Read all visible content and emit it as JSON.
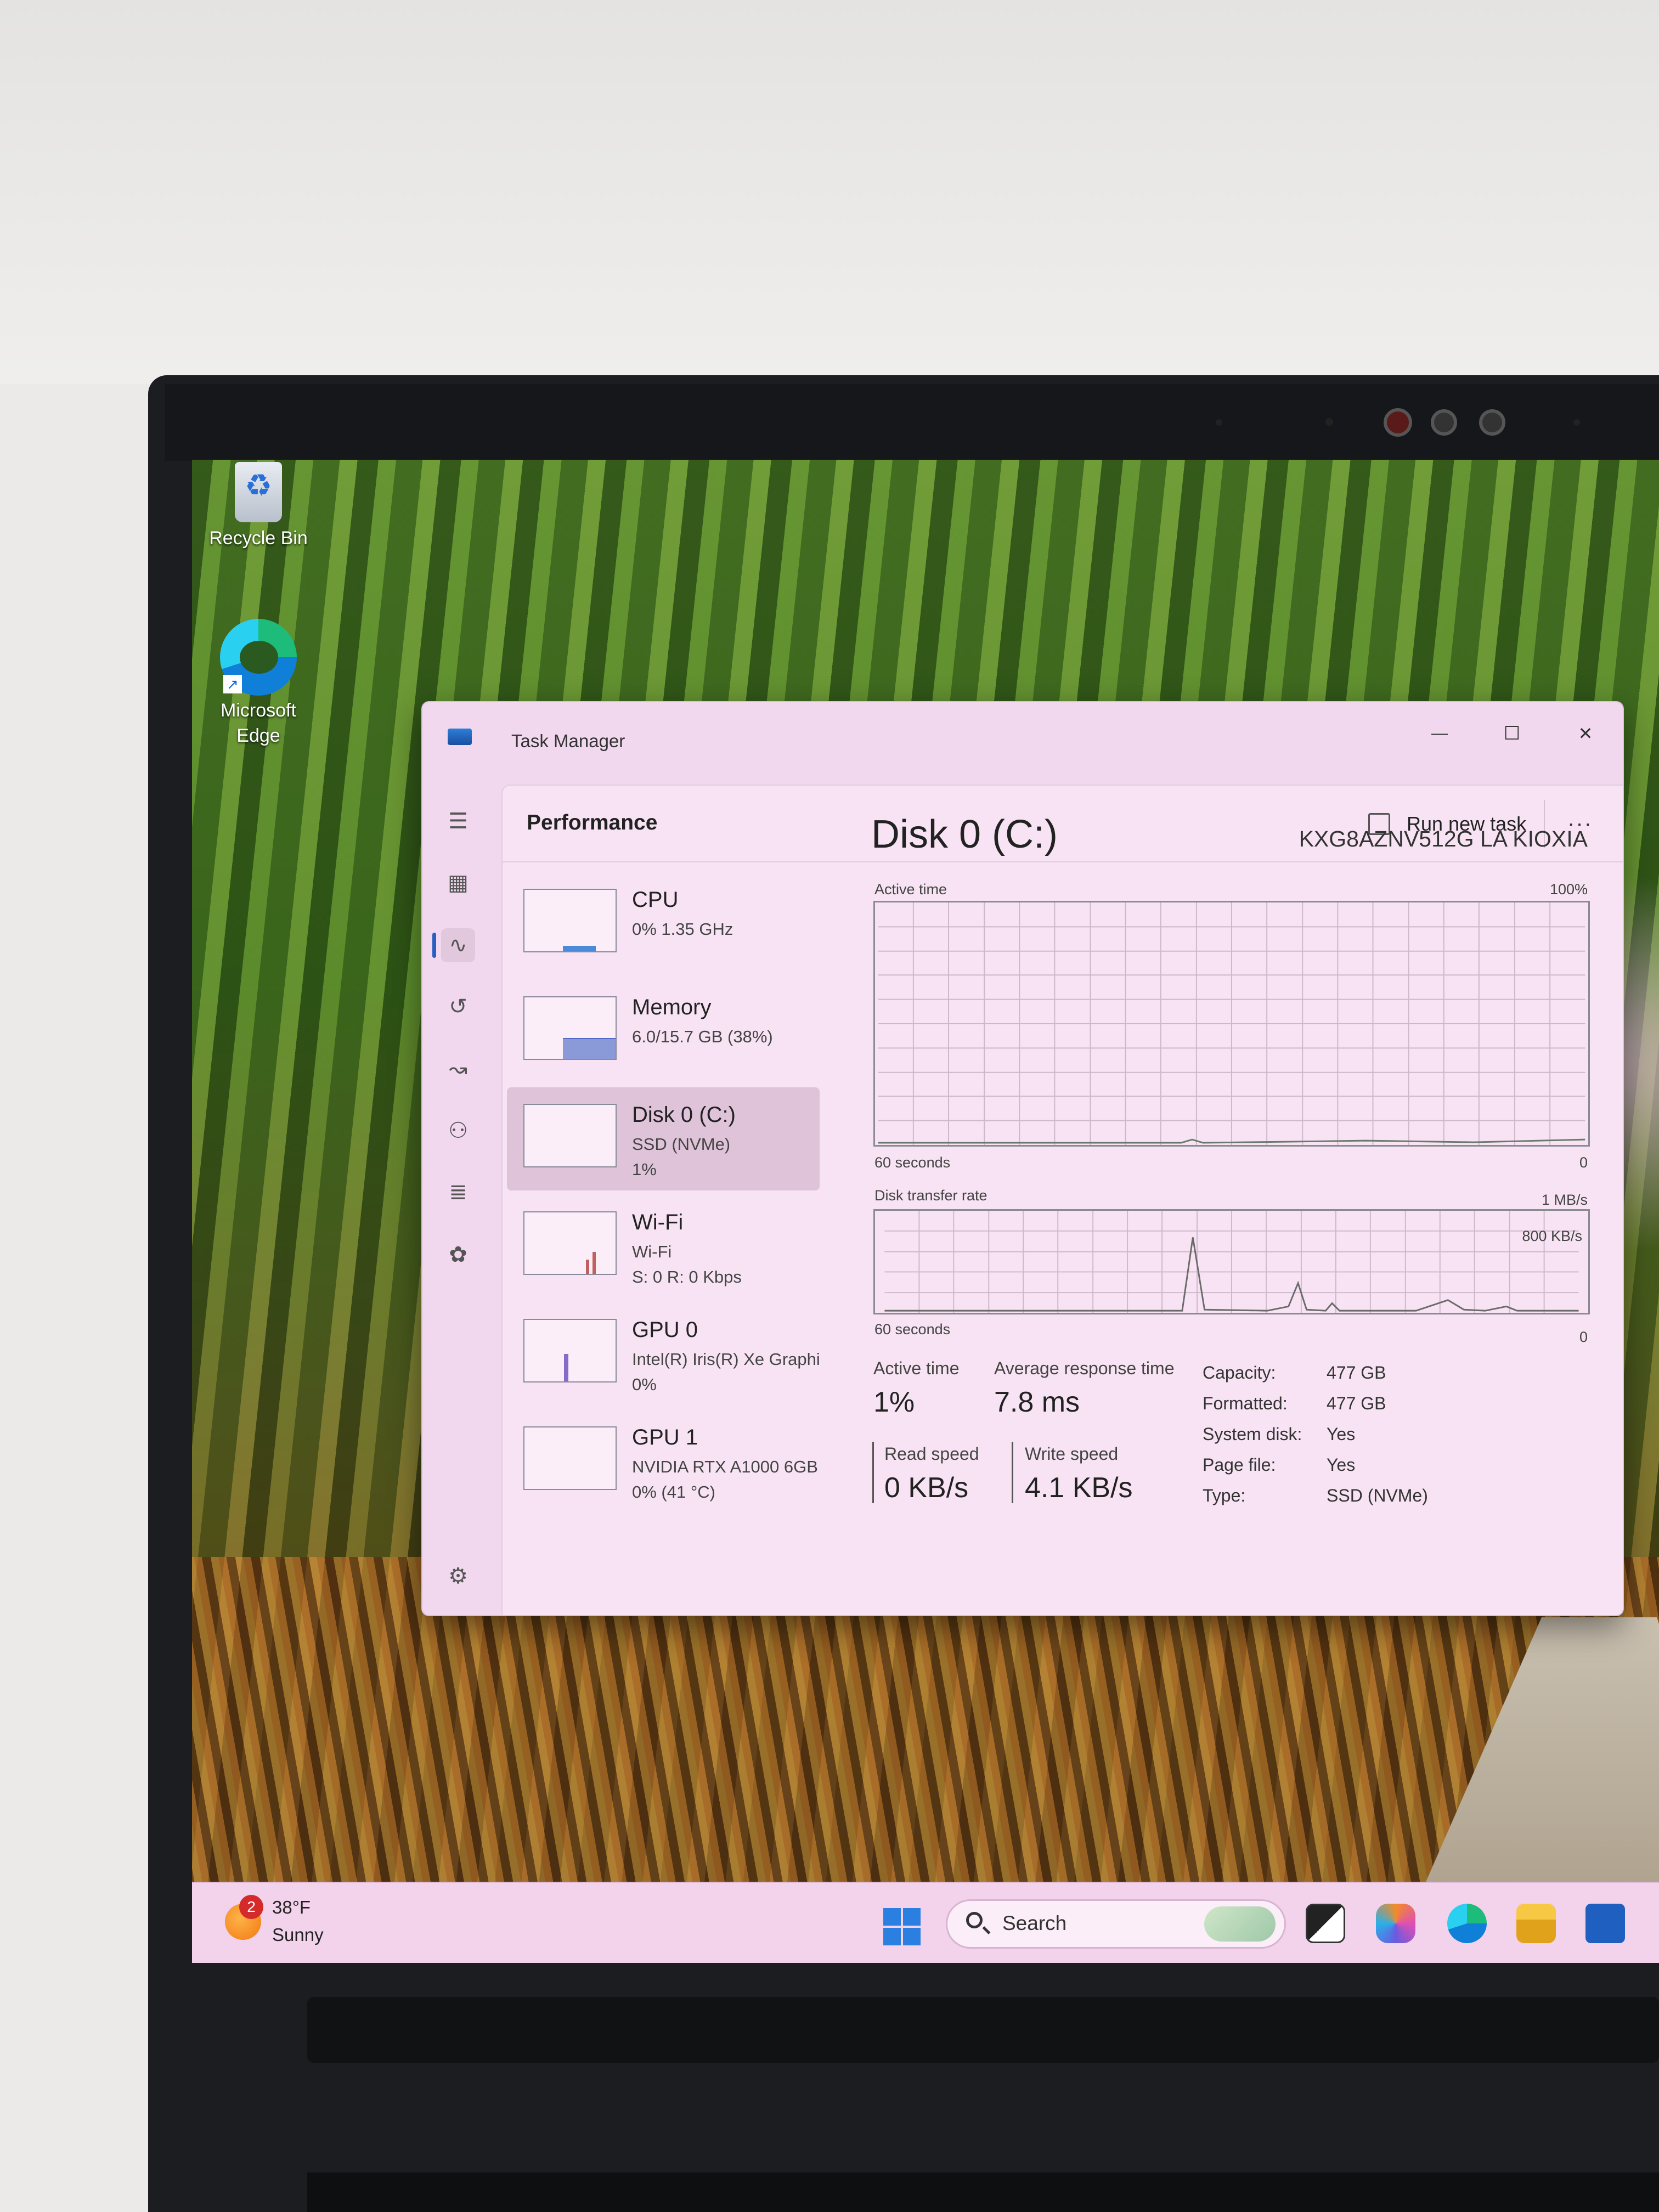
{
  "desktop": {
    "icons": [
      {
        "label": "Recycle Bin"
      },
      {
        "label": "Microsoft Edge"
      }
    ]
  },
  "task_manager": {
    "title": "Task Manager",
    "window_buttons": {
      "minimize": "—",
      "maximize": "☐",
      "close": "✕"
    },
    "page_title": "Performance",
    "run_new_task": "Run new task",
    "more": "···",
    "devices": [
      {
        "name": "CPU",
        "sub1": "0% 1.35 GHz",
        "sub2": ""
      },
      {
        "name": "Memory",
        "sub1": "6.0/15.7 GB (38%)",
        "sub2": ""
      },
      {
        "name": "Disk 0 (C:)",
        "sub1": "SSD (NVMe)",
        "sub2": "1%"
      },
      {
        "name": "Wi-Fi",
        "sub1": "Wi-Fi",
        "sub2": "S: 0 R: 0 Kbps"
      },
      {
        "name": "GPU 0",
        "sub1": "Intel(R) Iris(R) Xe Graphi",
        "sub2": "0%"
      },
      {
        "name": "GPU 1",
        "sub1": "NVIDIA RTX A1000 6GB",
        "sub2": "0% (41 °C)"
      }
    ],
    "detail": {
      "title": "Disk 0 (C:)",
      "model": "KXG8AZNV512G LA KIOXIA",
      "graph1": {
        "label": "Active time",
        "max": "100%",
        "time": "60 seconds",
        "min": "0"
      },
      "graph2": {
        "label": "Disk transfer rate",
        "max": "1 MB/s",
        "mid": "800 KB/s",
        "time": "60 seconds",
        "min": "0"
      },
      "active_time_label": "Active time",
      "active_time_value": "1%",
      "avg_response_label": "Average response time",
      "avg_response_value": "7.8 ms",
      "read_label": "Read speed",
      "read_value": "0 KB/s",
      "write_label": "Write speed",
      "write_value": "4.1 KB/s",
      "properties": [
        {
          "key": "Capacity:",
          "value": "477 GB"
        },
        {
          "key": "Formatted:",
          "value": "477 GB"
        },
        {
          "key": "System disk:",
          "value": "Yes"
        },
        {
          "key": "Page file:",
          "value": "Yes"
        },
        {
          "key": "Type:",
          "value": "SSD (NVMe)"
        }
      ]
    }
  },
  "taskbar": {
    "weather_badge": "2",
    "weather_temp": "38°F",
    "weather_desc": "Sunny",
    "search_placeholder": "Search"
  },
  "colors": {
    "accent": "#2b7fe0",
    "window_bg": "#f1d8ee",
    "selected_row": "#dfc3d9"
  }
}
